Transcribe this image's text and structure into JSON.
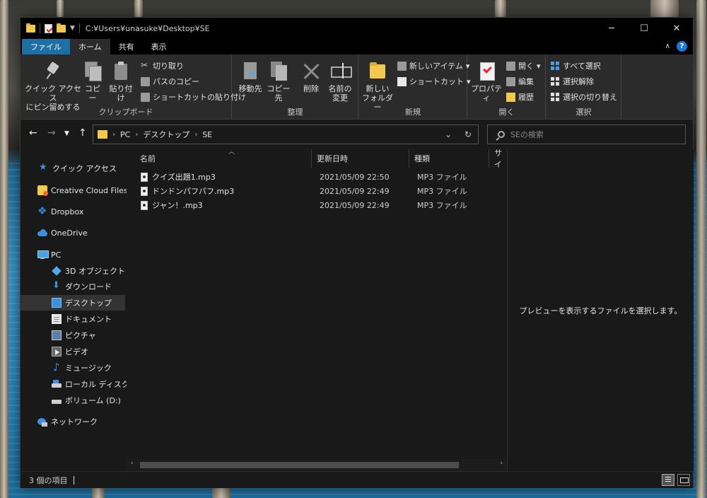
{
  "window": {
    "title_path": "C:¥Users¥unasuke¥Desktop¥SE",
    "controls": {
      "minimize": "─",
      "maximize": "☐",
      "close": "✕"
    }
  },
  "ribbon_tabs": [
    "ファイル",
    "ホーム",
    "共有",
    "表示"
  ],
  "ribbon": {
    "clipboard": {
      "pin_label_1": "クイック アクセス",
      "pin_label_2": "にピン留めする",
      "copy": "コピー",
      "paste": "貼り付け",
      "cut": "切り取り",
      "copy_path": "パスのコピー",
      "paste_shortcut": "ショートカットの貼り付け",
      "group": "クリップボード"
    },
    "organize": {
      "move_to": "移動先",
      "copy_to": "コピー先",
      "delete": "削除",
      "rename_1": "名前の",
      "rename_2": "変更",
      "group": "整理"
    },
    "new": {
      "new_folder_1": "新しい",
      "new_folder_2": "フォルダー",
      "new_item": "新しいアイテム",
      "shortcut": "ショートカット",
      "group": "新規"
    },
    "open": {
      "properties": "プロパティ",
      "open": "開く",
      "edit": "編集",
      "history": "履歴",
      "group": "開く"
    },
    "select": {
      "select_all": "すべて選択",
      "select_none": "選択解除",
      "invert": "選択の切り替え",
      "group": "選択"
    }
  },
  "address": {
    "crumbs": [
      "PC",
      "デスクトップ",
      "SE"
    ],
    "search_placeholder": "SEの検索"
  },
  "nav_pane": [
    {
      "label": "クイック アクセス",
      "icon": "star-icon"
    },
    {
      "label": "Creative Cloud Files",
      "icon": "creative-cloud-icon"
    },
    {
      "label": "Dropbox",
      "icon": "dropbox-icon"
    },
    {
      "label": "OneDrive",
      "icon": "onedrive-icon"
    },
    {
      "label": "PC",
      "icon": "pc-icon"
    },
    {
      "label": "3D オブジェクト",
      "icon": "3d-objects-icon"
    },
    {
      "label": "ダウンロード",
      "icon": "download-icon"
    },
    {
      "label": "デスクトップ",
      "icon": "desktop-icon",
      "selected": true
    },
    {
      "label": "ドキュメント",
      "icon": "document-icon"
    },
    {
      "label": "ピクチャ",
      "icon": "picture-icon"
    },
    {
      "label": "ビデオ",
      "icon": "video-icon"
    },
    {
      "label": "ミュージック",
      "icon": "music-icon"
    },
    {
      "label": "ローカル ディスク (C:)",
      "icon": "drive-icon"
    },
    {
      "label": "ボリューム (D:)",
      "icon": "drive-icon"
    },
    {
      "label": "ネットワーク",
      "icon": "network-icon"
    }
  ],
  "columns": [
    "名前",
    "更新日時",
    "種類",
    "サイ"
  ],
  "files": [
    {
      "name": "クイズ出題1.mp3",
      "date": "2021/05/09 22:50",
      "type": "MP3 ファイル"
    },
    {
      "name": "ドンドンパフパフ.mp3",
      "date": "2021/05/09 22:49",
      "type": "MP3 ファイル"
    },
    {
      "name": "ジャン！.mp3",
      "date": "2021/05/09 22:49",
      "type": "MP3 ファイル"
    }
  ],
  "preview_message": "プレビューを表示するファイルを選択します。",
  "status": {
    "item_count": "3 個の項目"
  },
  "colors": {
    "accent": "#1f6fa7",
    "folder": "#f2c94c",
    "background": "#191919"
  }
}
